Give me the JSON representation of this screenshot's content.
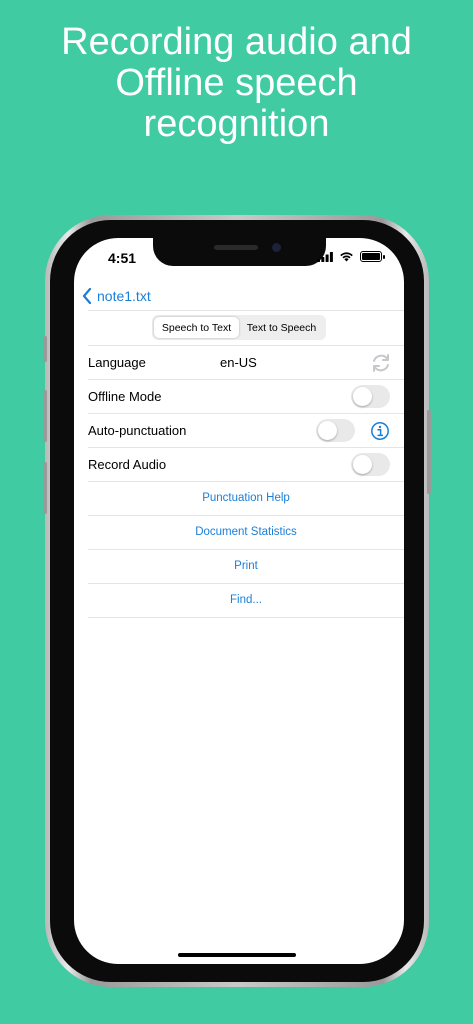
{
  "headline": {
    "line1": "Recording audio and",
    "line2": "Offline speech",
    "line3": "recognition"
  },
  "status_bar": {
    "time": "4:51",
    "icons": [
      "signal-icon",
      "wifi-icon",
      "battery-icon"
    ]
  },
  "nav": {
    "back_label": "note1.txt",
    "back_icon": "chevron-left-icon"
  },
  "segmented": {
    "options": [
      "Speech to Text",
      "Text to Speech"
    ],
    "selected": "Speech to Text"
  },
  "settings": {
    "language": {
      "label": "Language",
      "value": "en-US",
      "icon": "refresh-icon"
    },
    "offline_mode": {
      "label": "Offline Mode",
      "enabled": false
    },
    "auto_punctuation": {
      "label": "Auto-punctuation",
      "enabled": false,
      "icon": "info-icon"
    },
    "record_audio": {
      "label": "Record Audio",
      "enabled": false
    }
  },
  "actions": {
    "punctuation_help": "Punctuation Help",
    "document_statistics": "Document Statistics",
    "print": "Print",
    "find": "Find..."
  },
  "colors": {
    "background": "#41CBA2",
    "accent": "#1a7fd8",
    "toggle_off": "#e9e9ea"
  }
}
